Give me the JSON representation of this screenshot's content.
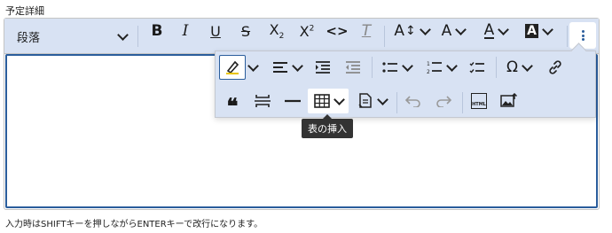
{
  "field": {
    "label": "予定詳細"
  },
  "toolbar": {
    "heading_value": "段落",
    "italic_label": "I",
    "bold_label": "B",
    "underline_label": "U",
    "strike_label": "S",
    "subscript_label": "X",
    "subscript_sub": "2",
    "superscript_label": "X",
    "superscript_sup": "2",
    "code_label": "<>",
    "clear_format_label": "T",
    "font_size_label": "A",
    "font_family_label": "A",
    "font_color_label": "A",
    "font_bg_label": "A",
    "special_char_label": "Ω",
    "html_label": "HTML",
    "blockquote_label": "❝"
  },
  "tooltip": {
    "text": "表の挿入"
  },
  "hint": "入力時はSHIFTキーを押しながらENTERキーで改行になります。",
  "colors": {
    "toolbar_bg": "#d8e2f3",
    "accent": "#2a5d9c",
    "tooltip_bg": "#333333"
  }
}
